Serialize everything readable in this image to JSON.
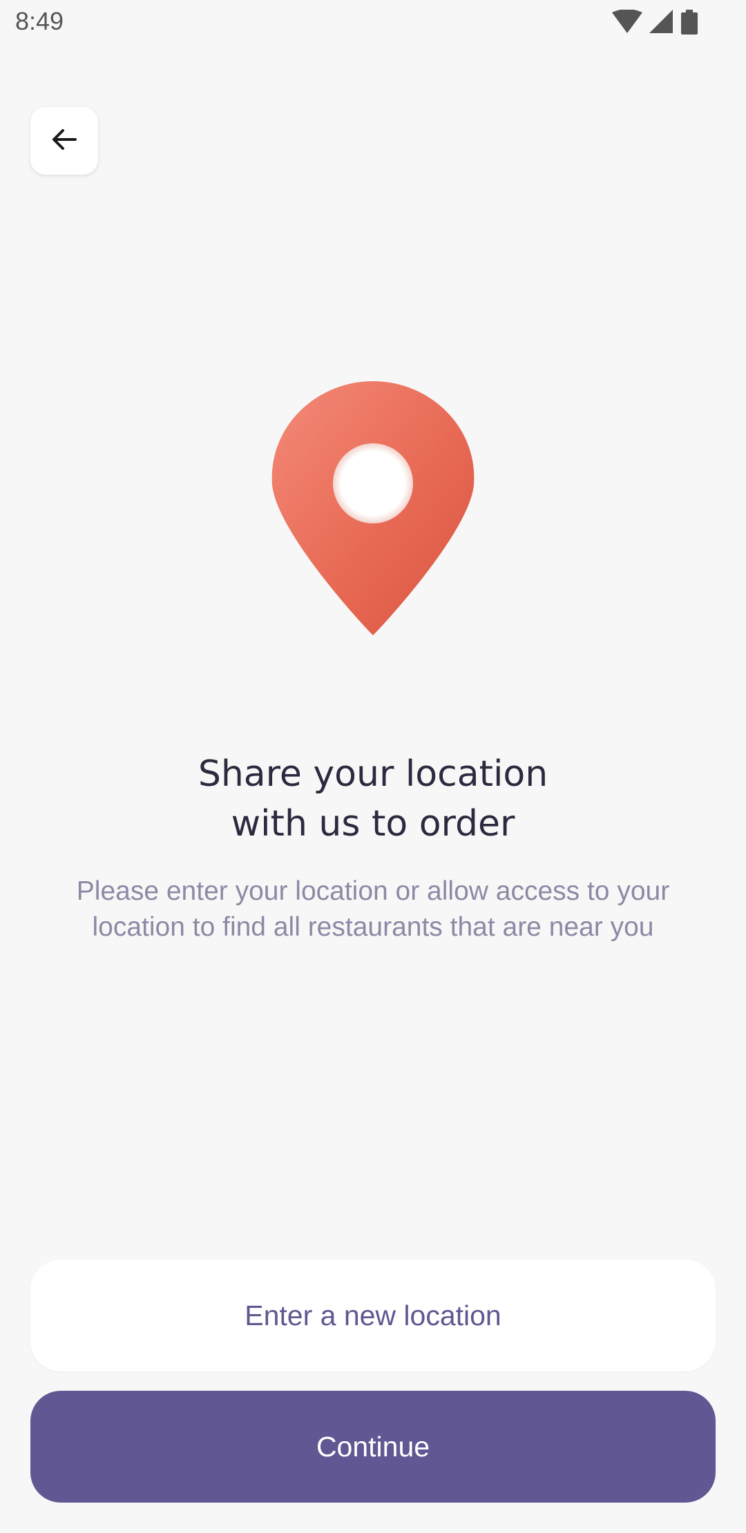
{
  "status_bar": {
    "time": "8:49",
    "icons": [
      "wifi-icon",
      "cellular-signal-icon",
      "battery-icon"
    ]
  },
  "header": {
    "back_icon": "arrow-left-icon"
  },
  "illustration": {
    "icon": "location-pin-icon",
    "color": "#e8654f"
  },
  "content": {
    "title_line_1": "Share your location",
    "title_line_2": "with us to order",
    "description": "Please enter your location or allow access to your location to find all restaurants that are near you"
  },
  "actions": {
    "secondary_label": "Enter a new location",
    "primary_label": "Continue"
  },
  "colors": {
    "background": "#f7f7f7",
    "primary": "#615893",
    "title_text": "#2b2a3f",
    "muted_text": "#8d89a5",
    "accent": "#e8654f"
  }
}
